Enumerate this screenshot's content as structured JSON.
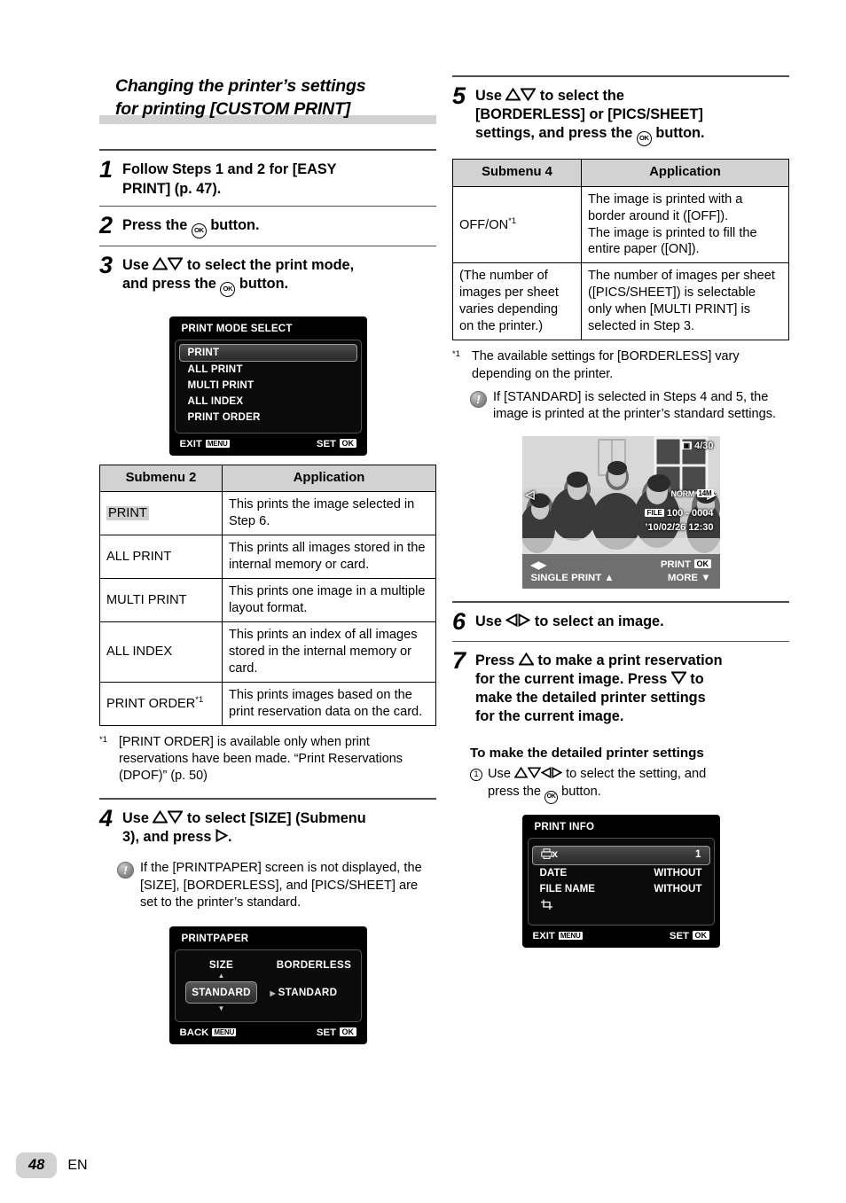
{
  "section": {
    "title_line1": "Changing the printer’s settings",
    "title_line2": "for printing [CUSTOM PRINT]"
  },
  "steps": {
    "s1": {
      "num": "1",
      "text_a": "Follow Steps 1 and 2 for [EASY",
      "text_b": "PRINT] (p. 47)."
    },
    "s2": {
      "num": "2",
      "text_a": "Press the ",
      "text_b": " button."
    },
    "s3": {
      "num": "3",
      "text_a": "Use ",
      "text_b": " to select the print mode,",
      "text_c": "and press the ",
      "text_d": " button."
    },
    "s4": {
      "num": "4",
      "text_a": "Use ",
      "text_b": " to select [SIZE] (Submenu",
      "text_c": "3), and press ",
      "text_d": "."
    },
    "s5": {
      "num": "5",
      "text_a": "Use ",
      "text_b": " to select the",
      "text_c": "[BORDERLESS] or [PICS/SHEET]",
      "text_d": "settings, and press the ",
      "text_e": " button."
    },
    "s6": {
      "num": "6",
      "text_a": "Use ",
      "text_b": " to select an image."
    },
    "s7": {
      "num": "7",
      "text_a": "Press ",
      "text_b": " to make a print reservation",
      "text_c": "for the current image. Press ",
      "text_d": " to",
      "text_e": "make the detailed printer settings",
      "text_f": "for the current image."
    }
  },
  "notes": {
    "step4_note": "If the [PRINTPAPER] screen is not displayed, the [SIZE], [BORDERLESS], and [PICS/SHEET] are set to the printer’s standard.",
    "step5_note": "If [STANDARD] is selected in Steps 4 and 5, the image is printed at the printer’s standard settings."
  },
  "footnotes": {
    "left_mark": "*1",
    "left_text": "[PRINT ORDER] is available only when print reservations have been made. “Print Reservations (DPOF)” (p. 50)",
    "right_mark": "*1",
    "right_text": "The available settings for [BORDERLESS] vary depending on the printer."
  },
  "detailed_settings": {
    "heading": "To make the detailed printer settings",
    "item1_num": "1",
    "item1_a": "Use ",
    "item1_b": " to select the setting, and",
    "item1_c": "press the ",
    "item1_d": " button."
  },
  "table_submenu2": {
    "headers": [
      "Submenu 2",
      "Application"
    ],
    "rows": [
      {
        "name": "PRINT",
        "highlight": true,
        "app": "This prints the image selected in Step 6."
      },
      {
        "name": "ALL PRINT",
        "highlight": false,
        "app": "This prints all images stored in the internal memory or card."
      },
      {
        "name": "MULTI PRINT",
        "highlight": false,
        "app": "This prints one image in a multiple layout format."
      },
      {
        "name": "ALL INDEX",
        "highlight": false,
        "app": "This prints an index of all images stored in the internal memory or card."
      },
      {
        "name": "PRINT ORDER",
        "sup": "*1",
        "highlight": false,
        "app": "This prints images based on the print reservation data on the card."
      }
    ]
  },
  "table_submenu4": {
    "headers": [
      "Submenu 4",
      "Application"
    ],
    "rows": [
      {
        "name": "OFF/ON",
        "sup": "*1",
        "app": "The image is printed with a border around it ([OFF]).\nThe image is printed to fill the entire paper ([ON])."
      },
      {
        "name": "(The number of images per sheet varies depending on the printer.)",
        "app": "The number of images per sheet ([PICS/SHEET]) is selectable only when [MULTI PRINT] is selected in Step 3."
      }
    ]
  },
  "lcd_print_mode": {
    "title": "PRINT MODE SELECT",
    "items": [
      "PRINT",
      "ALL PRINT",
      "MULTI PRINT",
      "ALL INDEX",
      "PRINT ORDER"
    ],
    "selected_index": 0,
    "foot_left": "EXIT",
    "foot_left_badge": "MENU",
    "foot_right": "SET",
    "foot_right_badge": "OK"
  },
  "lcd_printpaper": {
    "title": "PRINTPAPER",
    "col1_header": "SIZE",
    "col2_header": "BORDERLESS",
    "col1_value": "STANDARD",
    "col2_value": "STANDARD",
    "foot_left": "BACK",
    "foot_left_badge": "MENU",
    "foot_right": "SET",
    "foot_right_badge": "OK"
  },
  "lcd_print_info": {
    "title": "PRINT INFO",
    "rows": [
      {
        "icon": "printer-icon",
        "label": "x",
        "value": "1",
        "selected": true
      },
      {
        "label": "DATE",
        "value": "WITHOUT",
        "selected": false
      },
      {
        "label": "FILE NAME",
        "value": "WITHOUT",
        "selected": false
      },
      {
        "icon": "crop-icon",
        "label": "",
        "value": "",
        "selected": false
      }
    ],
    "foot_left": "EXIT",
    "foot_left_badge": "MENU",
    "foot_right": "SET",
    "foot_right_badge": "OK"
  },
  "photo_preview": {
    "frame_counter": "4/30",
    "card_icon": "card-icon",
    "quality": "NORM",
    "resolution": "14M",
    "file_badge": "FILE",
    "file_number": "100 - 0004",
    "date": "’10/02/26",
    "time": "12:30",
    "bar_top_right": "PRINT",
    "bar_top_right_badge": "OK",
    "bar_bottom_left": "SINGLE PRINT",
    "bar_bottom_right": "MORE"
  },
  "footer": {
    "page": "48",
    "lang": "EN"
  }
}
